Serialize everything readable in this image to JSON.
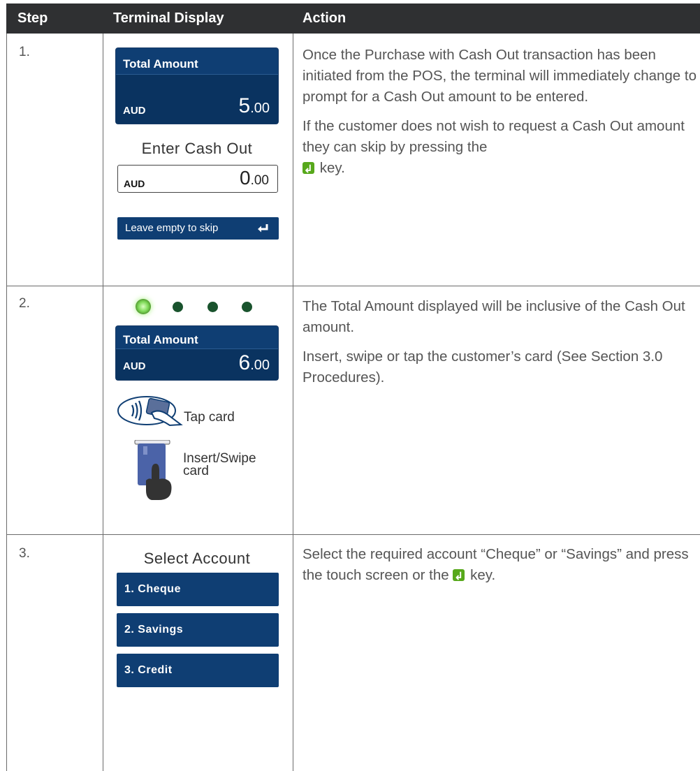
{
  "header": {
    "step": "Step",
    "display": "Terminal Display",
    "action": "Action"
  },
  "rows": [
    {
      "step": "1.",
      "display": {
        "total_label": "Total Amount",
        "currency": "AUD",
        "amount_int": "5",
        "amount_dec": ".00",
        "prompt": "Enter Cash Out",
        "input_currency": "AUD",
        "input_int": "0",
        "input_dec": ".00",
        "skip_button": "Leave empty to skip"
      },
      "action": {
        "p1": "Once the Purchase with Cash Out transaction has been initiated from the POS, the terminal will immediately change to prompt for a Cash Out amount to be entered.",
        "p2_before": "If the customer does not wish to request a Cash Out amount they can skip by pressing the",
        "p2_after": "key."
      }
    },
    {
      "step": "2.",
      "display": {
        "total_label": "Total Amount",
        "currency": "AUD",
        "amount_int": "6",
        "amount_dec": ".00",
        "tap_label": "Tap card",
        "insert_label_1": "Insert/Swipe",
        "insert_label_2": "card"
      },
      "action": {
        "p1": "The Total Amount displayed will be inclusive of the Cash Out amount.",
        "p2": "Insert, swipe or tap the customer’s card (See Section 3.0 Procedures)."
      }
    },
    {
      "step": "3.",
      "display": {
        "prompt": "Select Account",
        "options": [
          "1. Cheque",
          "2. Savings",
          "3. Credit"
        ]
      },
      "action": {
        "p1_before": "Select the required account “Cheque” or “Savings” and press the touch screen or the",
        "p1_after": "key."
      }
    }
  ],
  "colors": {
    "header_bg": "#2f3032",
    "panel_blue": "#0f3e73",
    "enter_key_green": "#57a81b",
    "indicator_green": "#7ed957"
  },
  "icons": [
    "contactless-tap-icon",
    "card-insert-swipe-icon",
    "enter-key-icon"
  ]
}
